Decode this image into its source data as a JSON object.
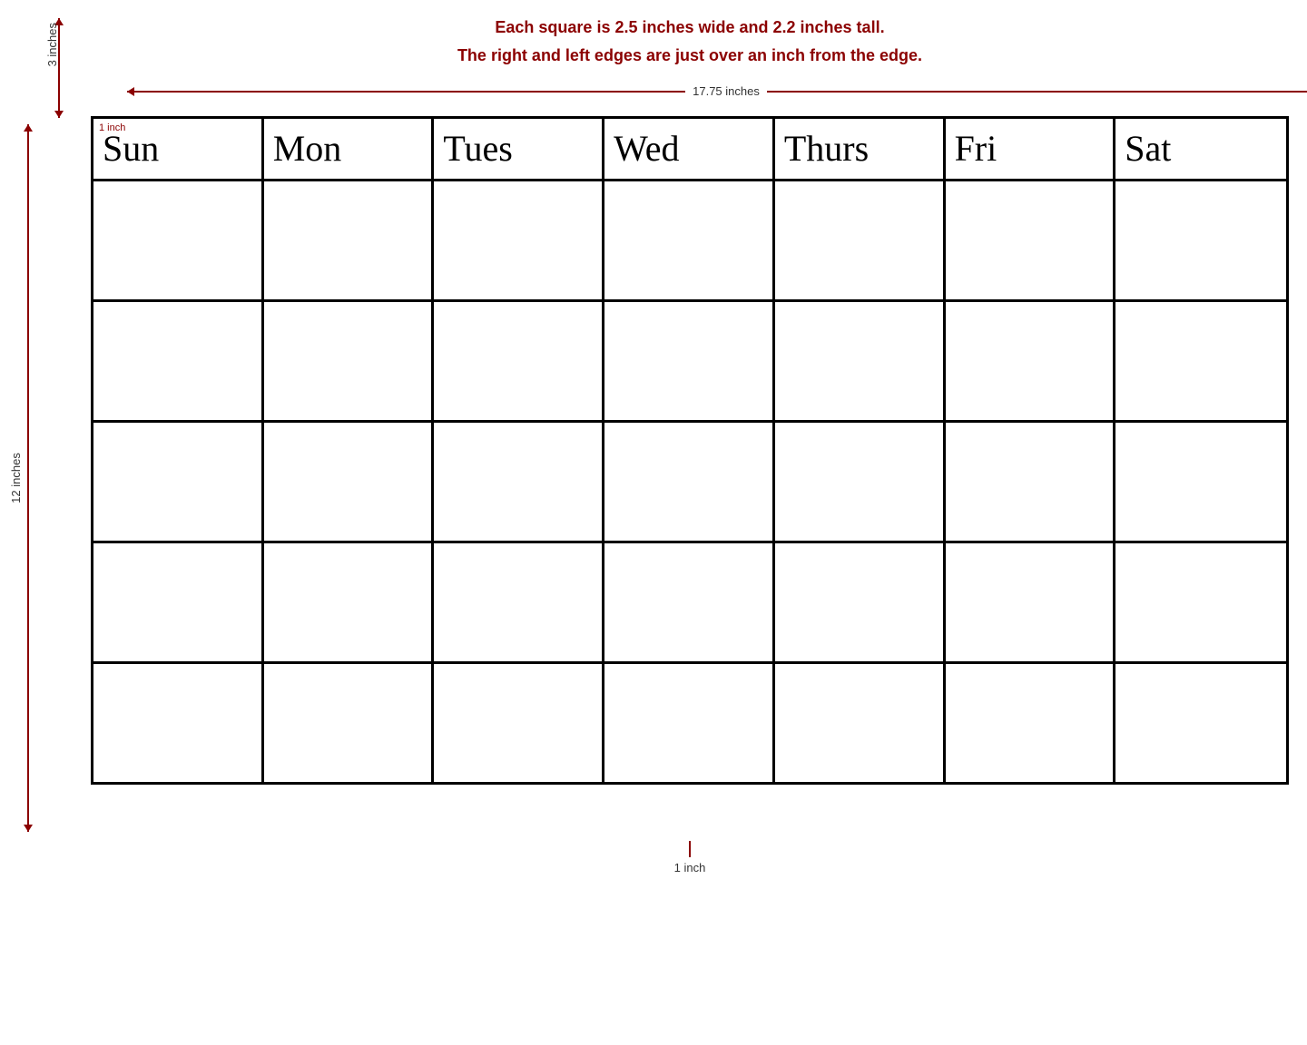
{
  "annotations": {
    "top_line1": "Each square is 2.5 inches wide and 2.2 inches tall.",
    "top_line2": "The right and left edges are just over an inch from the edge.",
    "width_label": "17.75 inches",
    "height_label": "12 inches",
    "top_height_label": "3 inches",
    "bottom_label": "1 inch",
    "top_left_label": "1 inch"
  },
  "days": [
    {
      "id": "sun",
      "label": "Sun"
    },
    {
      "id": "mon",
      "label": "Mon"
    },
    {
      "id": "tue",
      "label": "Tues"
    },
    {
      "id": "wed",
      "label": "Wed"
    },
    {
      "id": "thu",
      "label": "Thurs"
    },
    {
      "id": "fri",
      "label": "Fri"
    },
    {
      "id": "sat",
      "label": "Sat"
    }
  ],
  "rows": 5
}
